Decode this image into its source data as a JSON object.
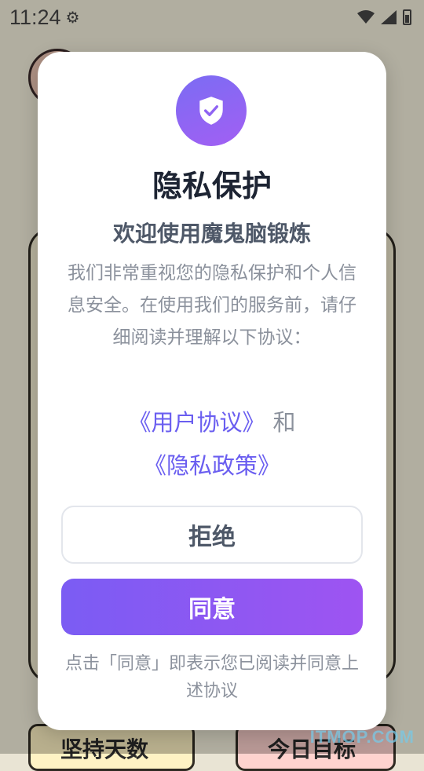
{
  "status_bar": {
    "time": "11:24",
    "icons": [
      "settings-icon",
      "wifi-icon",
      "signal-icon",
      "battery-charging-icon"
    ]
  },
  "background": {
    "stat_left": "坚持天数",
    "stat_right": "今日目标"
  },
  "dialog": {
    "icon": "shield-check-icon",
    "title": "隐私保护",
    "subtitle": "欢迎使用魔鬼脑锻炼",
    "body": "我们非常重视您的隐私保护和个人信息安全。在使用我们的服务前，请仔细阅读并理解以下协议：",
    "user_agreement": "《用户协议》",
    "and": "和",
    "privacy_policy": "《隐私政策》",
    "reject_label": "拒绝",
    "agree_label": "同意",
    "footnote": "点击「同意」即表示您已阅读并同意上述协议"
  },
  "colors": {
    "accent": "#7b5cf3",
    "link": "#6a5ef0",
    "title": "#1d2433",
    "muted": "#8b919c"
  },
  "watermark": "ITMOP.COM"
}
